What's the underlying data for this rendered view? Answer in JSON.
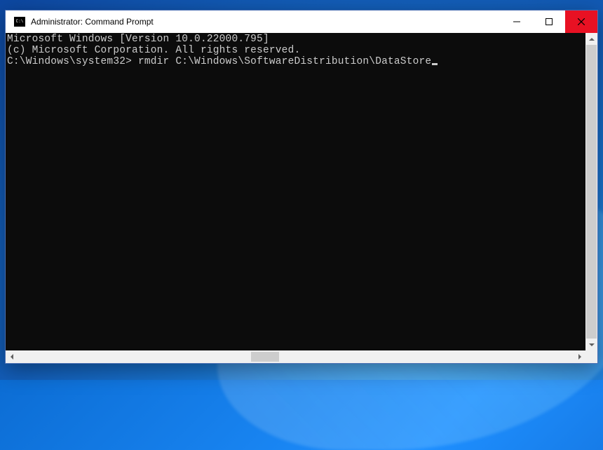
{
  "window": {
    "title": "Administrator: Command Prompt"
  },
  "terminal": {
    "line1": "Microsoft Windows [Version 10.0.22000.795]",
    "line2": "(c) Microsoft Corporation. All rights reserved.",
    "blank": "",
    "prompt": "C:\\Windows\\system32>",
    "command": "rmdir C:\\Windows\\SoftwareDistribution\\DataStore"
  }
}
